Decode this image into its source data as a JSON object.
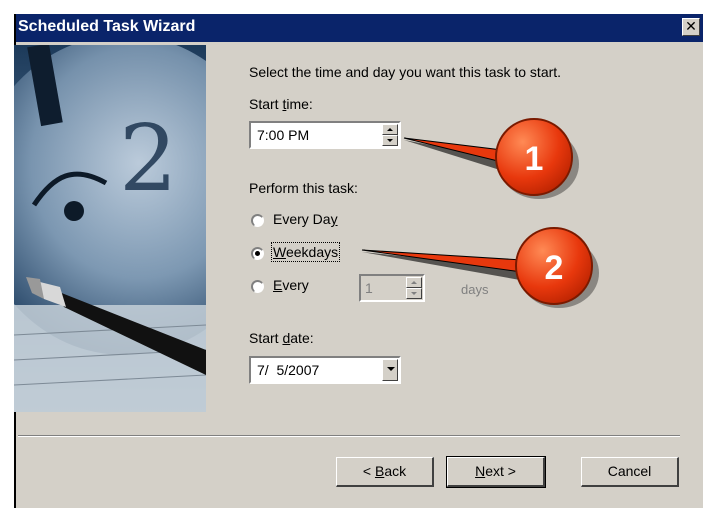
{
  "window": {
    "title": "Scheduled Task Wizard",
    "close_glyph": "✕"
  },
  "content": {
    "instruction": "Select the time and day you want this task to start.",
    "start_time": {
      "label_pre": "Start ",
      "label_u": "t",
      "label_post": "ime:",
      "value": "7:00 PM"
    },
    "perform": {
      "label": "Perform this task:",
      "options": [
        {
          "pre": "Every Da",
          "u": "y",
          "post": "",
          "selected": false
        },
        {
          "pre": "",
          "u": "W",
          "post": "eekdays",
          "selected": true
        },
        {
          "pre": "",
          "u": "E",
          "post": "very",
          "selected": false
        }
      ],
      "interval_value": "1",
      "interval_unit": "days"
    },
    "start_date": {
      "label_pre": "Start ",
      "label_u": "d",
      "label_post": "ate:",
      "value": "7/  5/2007"
    }
  },
  "buttons": {
    "back": {
      "pre": "< ",
      "u": "B",
      "post": "ack"
    },
    "next": {
      "pre": "",
      "u": "N",
      "post": "ext >"
    },
    "cancel": "Cancel"
  },
  "callouts": [
    {
      "number": "1",
      "color": "#e8380d"
    },
    {
      "number": "2",
      "color": "#e8380d"
    }
  ],
  "colors": {
    "titlebar": "#0a246a",
    "dialog_bg": "#d4d0c8",
    "callout": "#e8380d"
  }
}
